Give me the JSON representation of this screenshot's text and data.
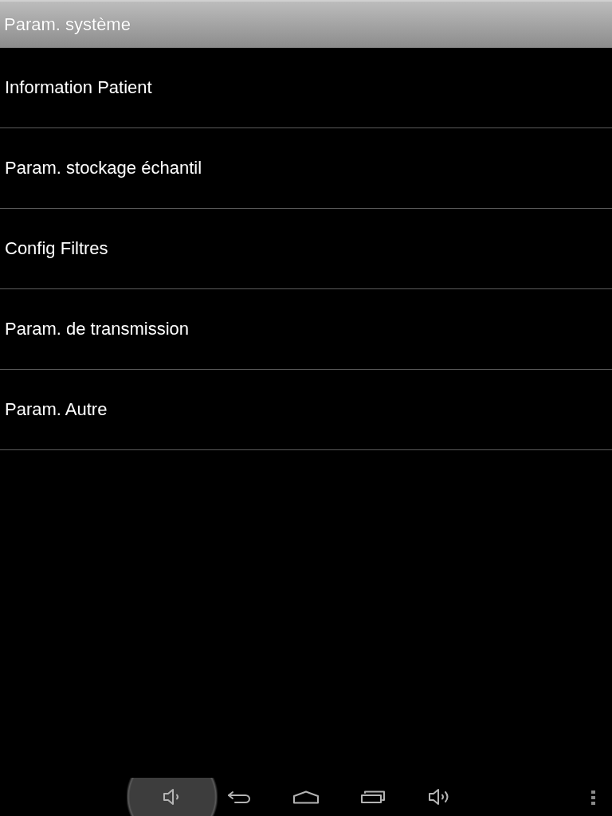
{
  "title_bar": {
    "title": "Param. système"
  },
  "menu_items": [
    {
      "label": "Information Patient"
    },
    {
      "label": "Param. stockage échantil"
    },
    {
      "label": "Config Filtres"
    },
    {
      "label": "Param. de transmission"
    },
    {
      "label": "Param. Autre"
    }
  ],
  "nav_bar": {
    "buttons": [
      {
        "kind": "volume_down",
        "pressed": true
      },
      {
        "kind": "back",
        "pressed": false
      },
      {
        "kind": "home",
        "pressed": false
      },
      {
        "kind": "recent",
        "pressed": false
      },
      {
        "kind": "volume_up",
        "pressed": false
      }
    ],
    "menu_button": {
      "kind": "overflow"
    }
  }
}
